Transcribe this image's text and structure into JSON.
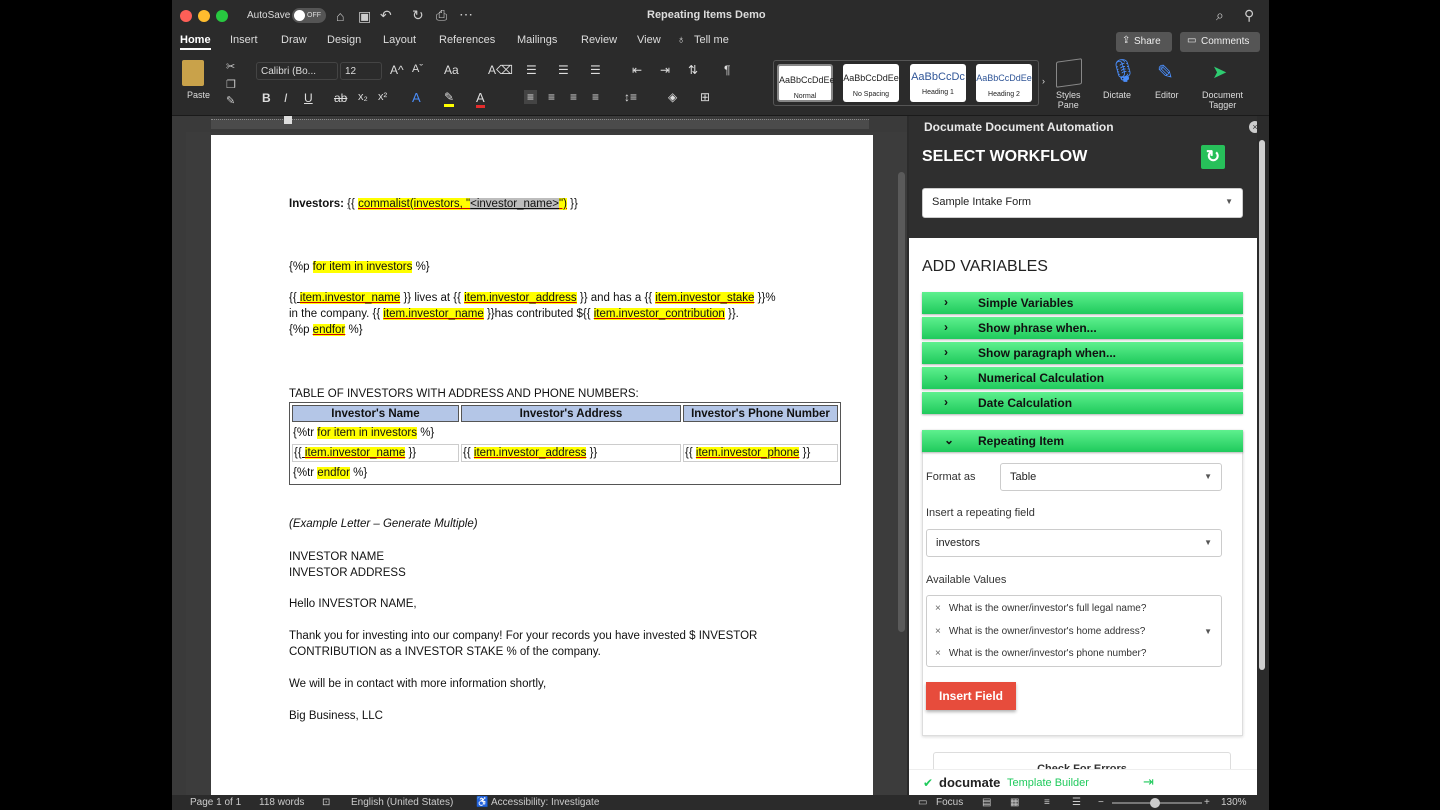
{
  "titlebar": {
    "autosave": "AutoSave",
    "autosave_state": "OFF",
    "doc_title": "Repeating Items Demo"
  },
  "tabs": [
    "Home",
    "Insert",
    "Draw",
    "Design",
    "Layout",
    "References",
    "Mailings",
    "Review",
    "View",
    "Tell me"
  ],
  "share": "Share",
  "comments": "Comments",
  "ribbon": {
    "paste": "Paste",
    "font": "Calibri (Bo...",
    "size": "12",
    "styles": [
      {
        "sample": "AaBbCcDdEe",
        "name": "Normal"
      },
      {
        "sample": "AaBbCcDdEe",
        "name": "No Spacing"
      },
      {
        "sample": "AaBbCcDc",
        "name": "Heading 1"
      },
      {
        "sample": "AaBbCcDdEe",
        "name": "Heading 2"
      }
    ],
    "styles_pane": "Styles\nPane",
    "dictate": "Dictate",
    "editor": "Editor",
    "tagger": "Document\nTagger"
  },
  "doc": {
    "investors_label": "Investors:",
    "c1": "{{",
    "commalist": "commalist(investors, \"",
    "inv_name_tag": "<investor_name>",
    "c2": "\")",
    "c3": " }}",
    "for_open": "{%p ",
    "for_text": "for item in investors",
    "for_close": " %}",
    "p1a": "{{ ",
    "p1b": "item.investor_name",
    "p1c": " }} lives at {{ ",
    "p1d": "item.investor_address",
    "p1e": " }} and has a {{ ",
    "p1f": "item.investor_stake",
    "p1g": " }}%",
    "p2a": "in the company. {{ ",
    "p2b": "item.investor_name",
    "p2c": " }}has contributed ${{ ",
    "p2d": "item.investor_contribution",
    "p2e": " }}.",
    "end_open": "{%p ",
    "end_text": "endfor",
    "end_close": " %}",
    "table_title": "TABLE OF INVESTORS WITH ADDRESS AND PHONE NUMBERS:",
    "th": [
      "Investor's Name",
      "Investor's Address",
      "Investor's Phone Number"
    ],
    "tr_for_a": "{%tr ",
    "tr_for_b": "for item in investors",
    "tr_for_c": " %}",
    "cell1a": "{{ ",
    "cell1b": "item.investor_name",
    "cell1c": " }}",
    "cell2a": "{{ ",
    "cell2b": "item.investor_address",
    "cell2c": " }}",
    "cell3a": "{{ ",
    "cell3b": "item.investor_phone",
    "cell3c": " }}",
    "tr_end_a": "{%tr ",
    "tr_end_b": "endfor",
    "tr_end_c": " %}",
    "example": "(Example Letter – Generate Multiple)",
    "inv_name": "INVESTOR NAME",
    "inv_addr": "INVESTOR ADDRESS",
    "hello": "Hello INVESTOR NAME,",
    "thanks1": "Thank you for investing into our company! For your records you have invested $ INVESTOR",
    "thanks2": "CONTRIBUTION as a INVESTOR STAKE % of the company.",
    "contact": "We will be in contact with more information shortly,",
    "sign": "Big Business, LLC"
  },
  "pane": {
    "title": "Documate Document Automation",
    "select_workflow": "SELECT WORKFLOW",
    "workflow": "Sample Intake Form",
    "add_variables": "ADD VARIABLES",
    "accordion": [
      "Simple Variables",
      "Show phrase when...",
      "Show paragraph when...",
      "Numerical Calculation",
      "Date Calculation"
    ],
    "repeating": "Repeating Item",
    "format_label": "Format as",
    "format_value": "Table",
    "insert_label": "Insert a repeating field",
    "insert_value": "investors",
    "avail_label": "Available Values",
    "values": [
      "What is the owner/investor's full legal name?",
      "What is the owner/investor's home address?",
      "What is the owner/investor's phone number?"
    ],
    "insert_button": "Insert Field",
    "check_errors": "Check For Errors",
    "brand": "documate",
    "brand_sub": "Template Builder"
  },
  "status": {
    "page": "Page 1 of 1",
    "words": "118 words",
    "lang": "English (United States)",
    "access": "Accessibility: Investigate",
    "focus": "Focus",
    "zoom": "130%"
  }
}
